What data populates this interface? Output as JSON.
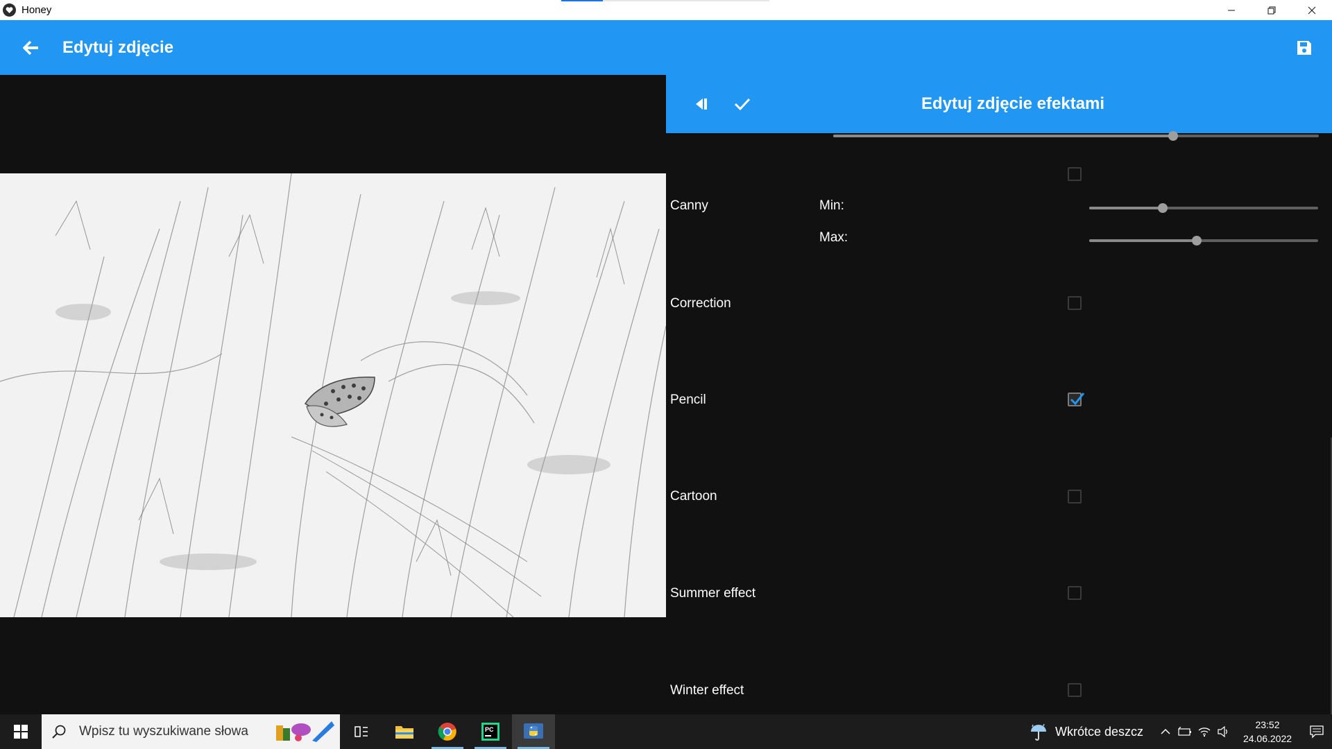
{
  "window": {
    "title": "Honey",
    "controls": {
      "minimize": "minimize-icon",
      "restore": "restore-icon",
      "close": "close-icon"
    }
  },
  "header": {
    "title": "Edytuj zdjęcie",
    "back_icon": "arrow-left-icon",
    "save_icon": "floppy-disk-icon",
    "color": "#2196f3"
  },
  "panel": {
    "title": "Edytuj zdjęcie efektami",
    "collapse_icon": "collapse-left-icon",
    "apply_icon": "checkmark-icon",
    "effects": [
      {
        "label": "",
        "checked": false
      },
      {
        "label": "Canny",
        "params": [
          {
            "label": "Min:",
            "value": 0.32
          },
          {
            "label": "Max:",
            "value": 0.47
          }
        ]
      },
      {
        "label": "Correction",
        "checked": false
      },
      {
        "label": "Pencil",
        "checked": true
      },
      {
        "label": "Cartoon",
        "checked": false
      },
      {
        "label": "Summer effect",
        "checked": false
      },
      {
        "label": "Winter effect",
        "checked": false
      }
    ],
    "top_slider_value": 0.7
  },
  "taskbar": {
    "search_placeholder": "Wpisz tu wyszukiwane słowa",
    "apps": [
      "task-view-icon",
      "file-explorer-icon",
      "chrome-icon",
      "pycharm-icon",
      "python-icon"
    ],
    "weather": "Wkrótce deszcz",
    "time": "23:52",
    "date": "24.06.2022"
  }
}
